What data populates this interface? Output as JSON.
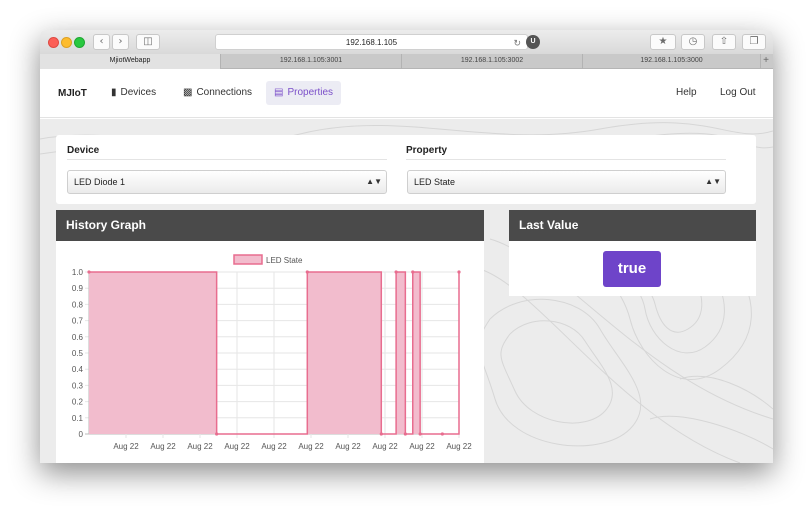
{
  "browser": {
    "address": "192.168.1.105",
    "tabs": [
      "MjiotWebapp",
      "192.168.1.105:3001",
      "192.168.1.105:3002",
      "192.168.1.105:3000"
    ],
    "active_tab": 0
  },
  "nav": {
    "brand": "MJIoT",
    "items": [
      {
        "label": "Devices",
        "icon": "device-icon"
      },
      {
        "label": "Connections",
        "icon": "sitemap-icon"
      },
      {
        "label": "Properties",
        "icon": "area-chart-icon"
      }
    ],
    "active": 2,
    "help": "Help",
    "logout": "Log Out"
  },
  "form": {
    "device_label": "Device",
    "device_value": "LED Diode 1",
    "property_label": "Property",
    "property_value": "LED State"
  },
  "history": {
    "title": "History Graph"
  },
  "last_value": {
    "title": "Last Value",
    "value": "true"
  },
  "colors": {
    "accent": "#6e44c9",
    "series_fill": "#f2bccd",
    "series_stroke": "#e86d8f",
    "panel_header": "#4a4a4a"
  },
  "chart_data": {
    "type": "area",
    "legend": [
      "LED State"
    ],
    "legend_position": "top",
    "x_tick_labels": [
      "Aug 22",
      "Aug 22",
      "Aug 22",
      "Aug 22",
      "Aug 22",
      "Aug 22",
      "Aug 22",
      "Aug 22",
      "Aug 22",
      "Aug 22"
    ],
    "y_tick_labels": [
      "1.0",
      "0.9",
      "0.8",
      "0.7",
      "0.6",
      "0.5",
      "0.4",
      "0.3",
      "0.2",
      "0.1",
      "0"
    ],
    "ylim": [
      0,
      1
    ],
    "x_range": [
      0,
      10
    ],
    "grid": true,
    "series": [
      {
        "name": "LED State",
        "stepped": true,
        "x": [
          0.0,
          3.45,
          5.9,
          7.9,
          8.3,
          8.55,
          8.75,
          8.95,
          9.55,
          10.0
        ],
        "values": [
          1,
          0,
          1,
          0,
          1,
          0,
          1,
          0,
          0,
          1
        ]
      }
    ]
  }
}
